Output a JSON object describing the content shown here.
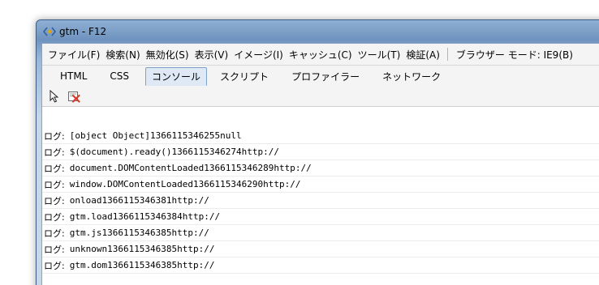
{
  "window": {
    "title": "gtm - F12"
  },
  "menubar": {
    "items": [
      "ファイル(F)",
      "検索(N)",
      "無効化(S)",
      "表示(V)",
      "イメージ(I)",
      "キャッシュ(C)",
      "ツール(T)",
      "検証(A)"
    ],
    "browser_mode": "ブラウザー モード: IE9(B)"
  },
  "tabs": {
    "items": [
      {
        "label": "HTML",
        "active": false
      },
      {
        "label": "CSS",
        "active": false
      },
      {
        "label": "コンソール",
        "active": true
      },
      {
        "label": "スクリプト",
        "active": false
      },
      {
        "label": "プロファイラー",
        "active": false
      },
      {
        "label": "ネットワーク",
        "active": false
      }
    ]
  },
  "toolbar": {
    "select_icon": "cursor-select-icon",
    "clear_icon": "clear-console-icon"
  },
  "console": {
    "prefix": "ログ:",
    "lines": [
      "[object Object]1366115346255null",
      "$(document).ready()1366115346274http://",
      "document.DOMContentLoaded1366115346289http://",
      "window.DOMContentLoaded1366115346290http://",
      "onload1366115346381http://",
      "gtm.load1366115346384http://",
      "gtm.js1366115346385http://",
      "unknown1366115346385http://",
      "gtm.dom1366115346385http://"
    ]
  },
  "colors": {
    "title_bar": "#6f93bf",
    "active_tab": "#dfe9f5",
    "clear_icon": "#d93a2b"
  }
}
